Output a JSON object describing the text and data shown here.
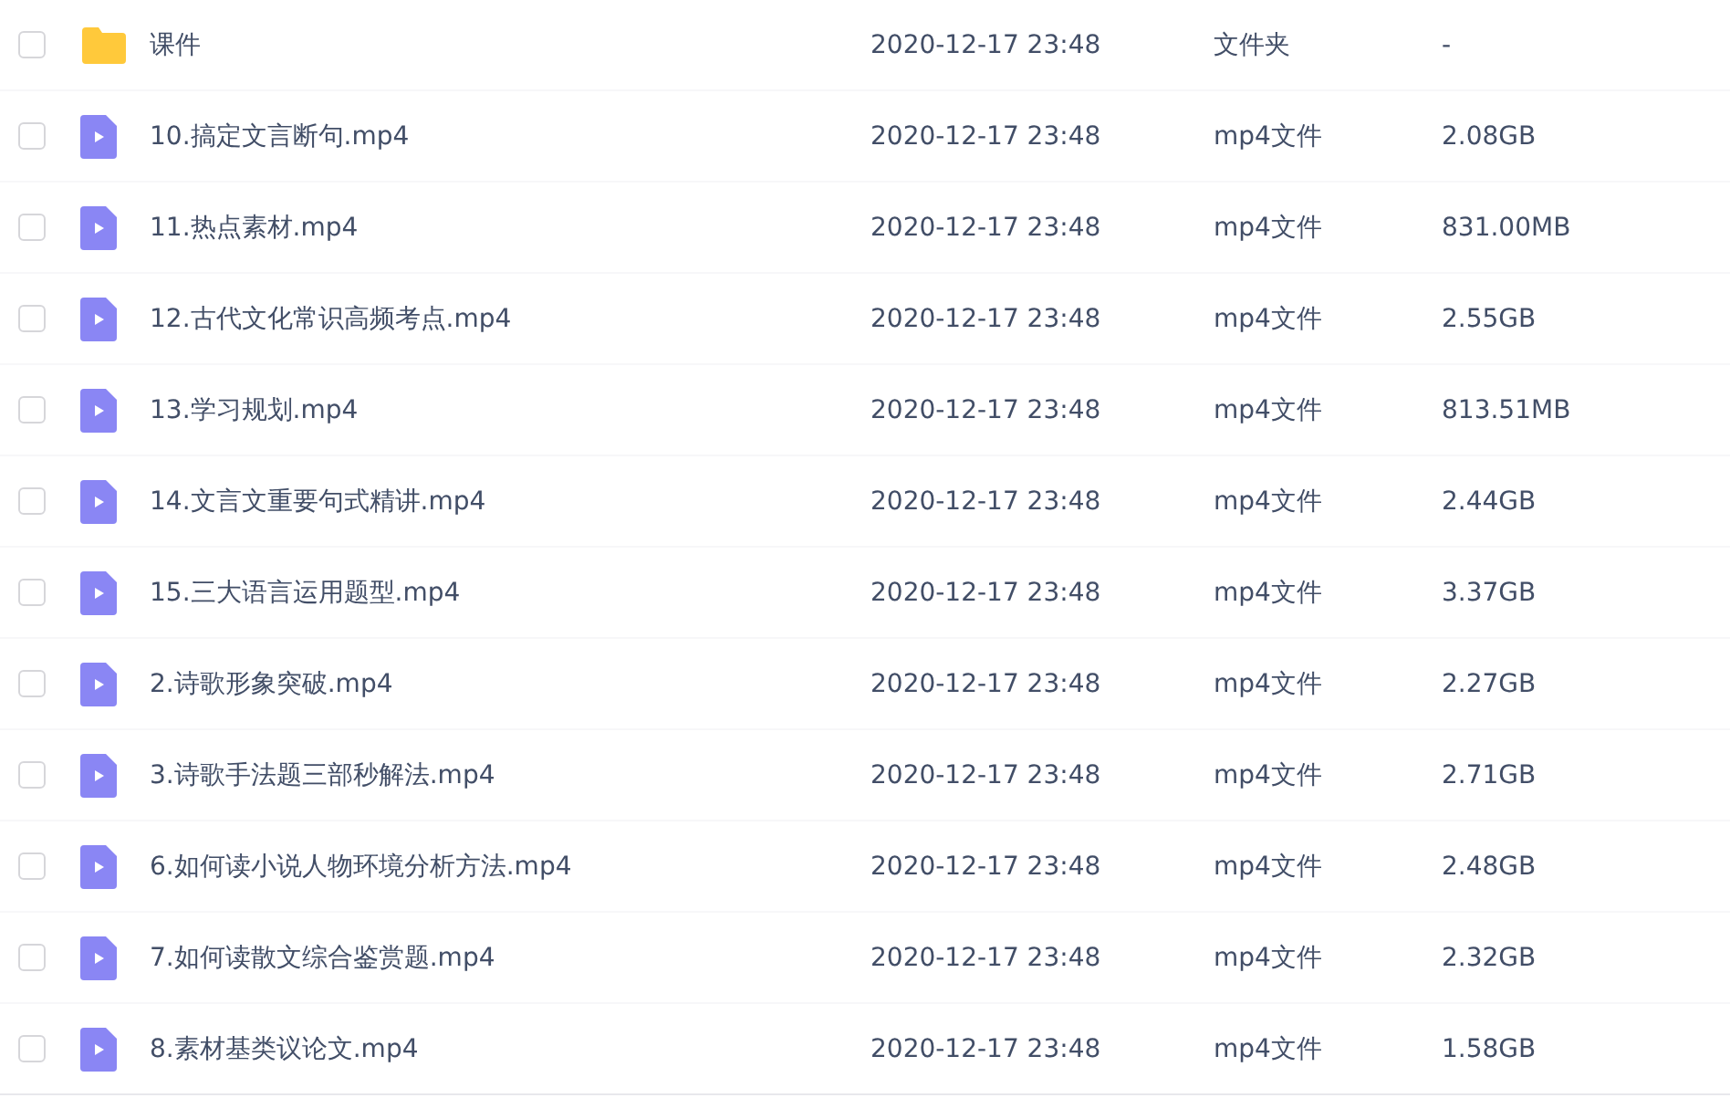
{
  "files": [
    {
      "kind": "folder",
      "checked": false,
      "name": "课件",
      "modified": "2020-12-17 23:48",
      "type": "文件夹",
      "size": "-"
    },
    {
      "kind": "video",
      "checked": false,
      "name": "10.搞定文言断句.mp4",
      "modified": "2020-12-17 23:48",
      "type": "mp4文件",
      "size": "2.08GB"
    },
    {
      "kind": "video",
      "checked": false,
      "name": "11.热点素材.mp4",
      "modified": "2020-12-17 23:48",
      "type": "mp4文件",
      "size": "831.00MB"
    },
    {
      "kind": "video",
      "checked": false,
      "name": "12.古代文化常识高频考点.mp4",
      "modified": "2020-12-17 23:48",
      "type": "mp4文件",
      "size": "2.55GB"
    },
    {
      "kind": "video",
      "checked": false,
      "name": "13.学习规划.mp4",
      "modified": "2020-12-17 23:48",
      "type": "mp4文件",
      "size": "813.51MB"
    },
    {
      "kind": "video",
      "checked": false,
      "name": "14.文言文重要句式精讲.mp4",
      "modified": "2020-12-17 23:48",
      "type": "mp4文件",
      "size": "2.44GB"
    },
    {
      "kind": "video",
      "checked": false,
      "name": "15.三大语言运用题型.mp4",
      "modified": "2020-12-17 23:48",
      "type": "mp4文件",
      "size": "3.37GB"
    },
    {
      "kind": "video",
      "checked": false,
      "name": "2.诗歌形象突破.mp4",
      "modified": "2020-12-17 23:48",
      "type": "mp4文件",
      "size": "2.27GB"
    },
    {
      "kind": "video",
      "checked": false,
      "name": "3.诗歌手法题三部秒解法.mp4",
      "modified": "2020-12-17 23:48",
      "type": "mp4文件",
      "size": "2.71GB"
    },
    {
      "kind": "video",
      "checked": false,
      "name": "6.如何读小说人物环境分析方法.mp4",
      "modified": "2020-12-17 23:48",
      "type": "mp4文件",
      "size": "2.48GB"
    },
    {
      "kind": "video",
      "checked": false,
      "name": "7.如何读散文综合鉴赏题.mp4",
      "modified": "2020-12-17 23:48",
      "type": "mp4文件",
      "size": "2.32GB"
    },
    {
      "kind": "video",
      "checked": false,
      "name": "8.素材基类议论文.mp4",
      "modified": "2020-12-17 23:48",
      "type": "mp4文件",
      "size": "1.58GB"
    }
  ]
}
